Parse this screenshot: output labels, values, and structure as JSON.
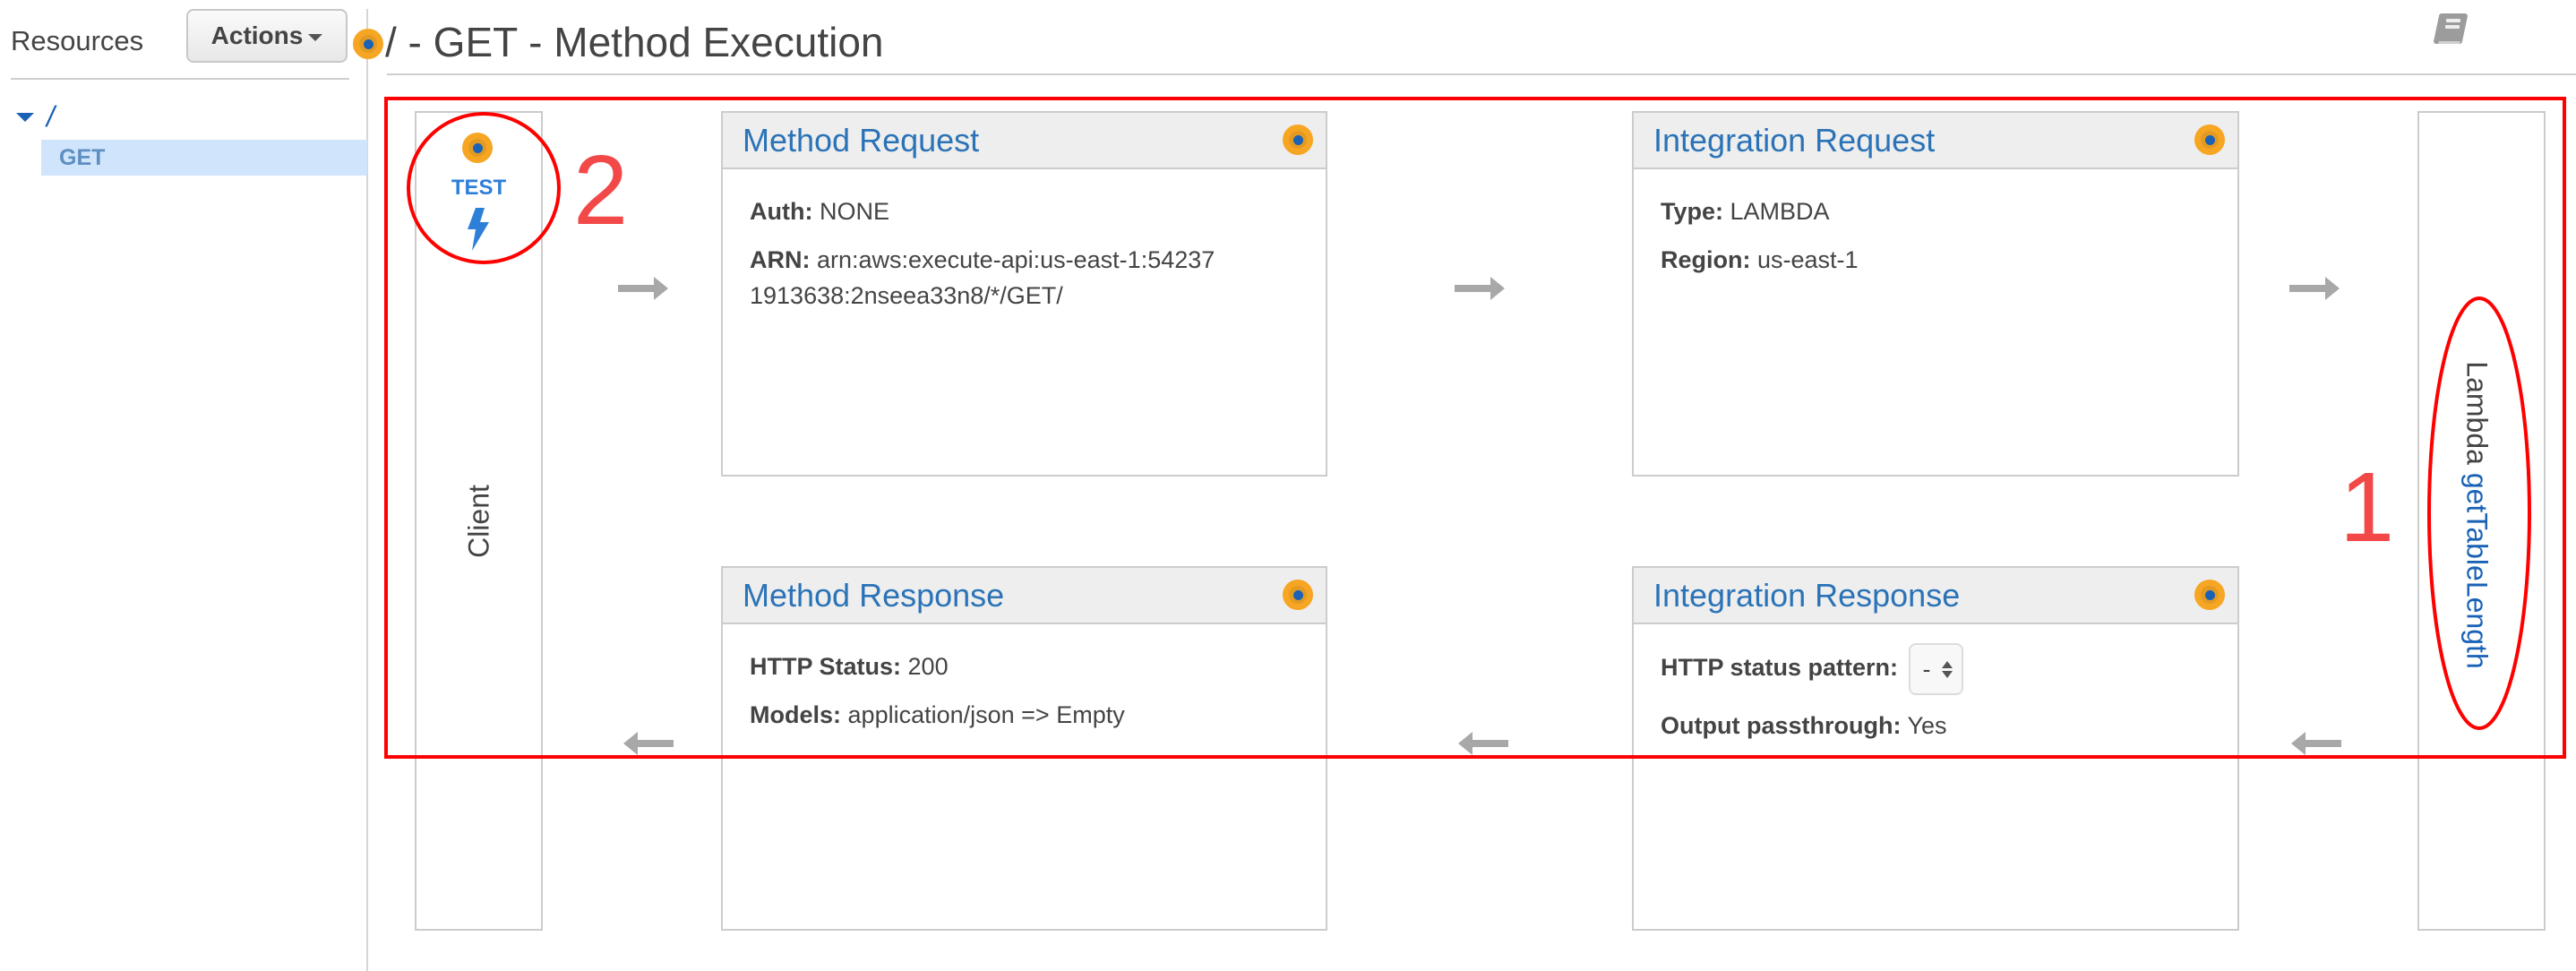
{
  "sidebar": {
    "title": "Resources",
    "actions_label": "Actions",
    "tree": {
      "root": "/",
      "children": [
        {
          "label": "GET",
          "selected": true
        }
      ]
    }
  },
  "header": {
    "title": "/ - GET - Method Execution",
    "docs_icon": "book-icon"
  },
  "client": {
    "test_label": "TEST",
    "label": "Client",
    "test_icon": "lightning-bolt-icon"
  },
  "method_request": {
    "title": "Method Request",
    "fields": [
      {
        "label": "Auth:",
        "value": "NONE"
      },
      {
        "label": "ARN:",
        "value": "arn:aws:execute-api:us-east-1:542371913638:2nseea33n8/*/GET/"
      }
    ]
  },
  "integration_request": {
    "title": "Integration Request",
    "fields": [
      {
        "label": "Type:",
        "value": "LAMBDA"
      },
      {
        "label": "Region:",
        "value": "us-east-1"
      }
    ]
  },
  "method_response": {
    "title": "Method Response",
    "fields": [
      {
        "label": "HTTP Status:",
        "value": "200"
      },
      {
        "label": "Models:",
        "value": "application/json => Empty"
      }
    ]
  },
  "integration_response": {
    "title": "Integration Response",
    "status_pattern_label": "HTTP status pattern:",
    "status_pattern_value": "-",
    "passthrough_label": "Output passthrough:",
    "passthrough_value": "Yes"
  },
  "lambda": {
    "prefix": "Lambda",
    "function_name": "getTableLength"
  },
  "annotations": {
    "marker_1": "1",
    "marker_2": "2",
    "color": "#ff0000"
  },
  "colors": {
    "link_blue": "#2b73b7",
    "status_orange": "#f6a623",
    "selected_bg": "#d0e5fb"
  }
}
